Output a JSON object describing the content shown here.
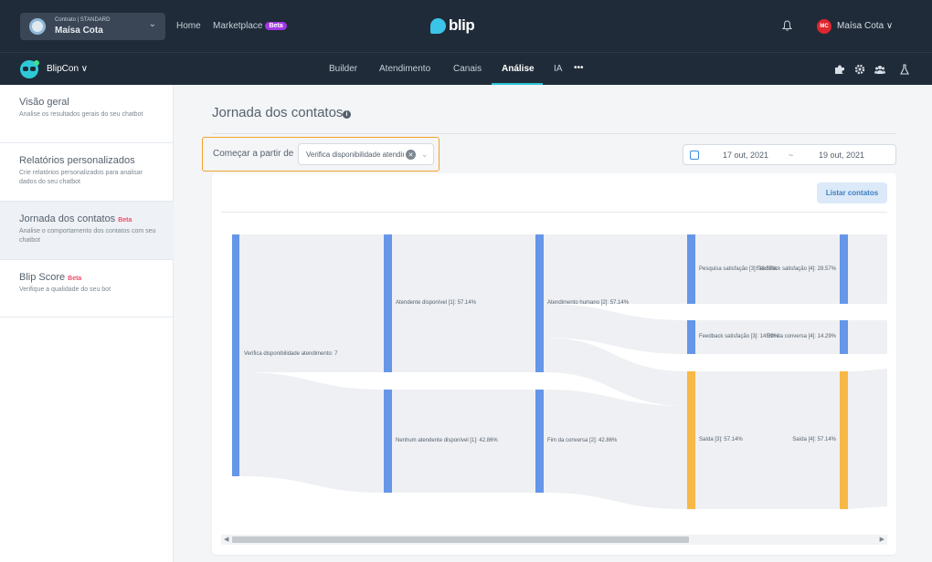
{
  "topbar": {
    "contract_small": "Contrato | STANDARD",
    "contract_name": "Maísa Cota",
    "home": "Home",
    "marketplace": "Marketplace",
    "marketplace_badge": "Beta",
    "logo": "blip",
    "user_initials": "MC",
    "user_name": "Maísa Cota ∨"
  },
  "botbar": {
    "bot_name": "BlipCon ∨",
    "tabs": [
      "Builder",
      "Atendimento",
      "Canais",
      "Análise",
      "IA",
      "•••"
    ],
    "active_tab": "Análise"
  },
  "sidebar": {
    "items": [
      {
        "title": "Visão geral",
        "beta": "",
        "desc": "Analise os resultados gerais do seu chatbot"
      },
      {
        "title": "Relatórios personalizados",
        "beta": "",
        "desc": "Crie relatórios personalizados para analisar dados do seu chatbot"
      },
      {
        "title": "Jornada dos contatos",
        "beta": "Beta",
        "desc": "Analise o comportamento dos contatos com seu chatbot"
      },
      {
        "title": "Blip Score",
        "beta": "Beta",
        "desc": "Verifique a qualidade do seu bot"
      }
    ]
  },
  "main": {
    "title": "Jornada dos contatos",
    "start_label": "Começar a partir de",
    "start_value": "Verifica disponibilidade atendimento",
    "date_from": "17 out, 2021",
    "date_sep": "~",
    "date_to": "19 out, 2021",
    "list_button": "Listar contatos"
  },
  "sankey": {
    "colors": {
      "node": "#6596e8",
      "exit": "#f7b846",
      "link": "#eef0f3"
    },
    "nodes": [
      {
        "id": "n0",
        "label": "Verifica disponibilidade atendimento: 7"
      },
      {
        "id": "n1",
        "label": "Atendente disponível [1]: 57.14%"
      },
      {
        "id": "n2",
        "label": "Nenhum atendente disponível [1]: 42.86%"
      },
      {
        "id": "n3",
        "label": "Atendimento humano [2]: 57.14%"
      },
      {
        "id": "n4",
        "label": "Fim da conversa [2]: 42.86%"
      },
      {
        "id": "n5",
        "label": "Pesquisa satisfação [3]: 28.57%"
      },
      {
        "id": "n6",
        "label": "Feedback satisfação [3]: 14.29%"
      },
      {
        "id": "n7",
        "label": "Saída [3]: 57.14%"
      },
      {
        "id": "n8",
        "label": "Feedback satisfação [4]: 28.57%"
      },
      {
        "id": "n9",
        "label": "Fim da conversa [4]: 14.29%"
      },
      {
        "id": "n10",
        "label": "Saída [4]: 57.14%"
      }
    ]
  }
}
